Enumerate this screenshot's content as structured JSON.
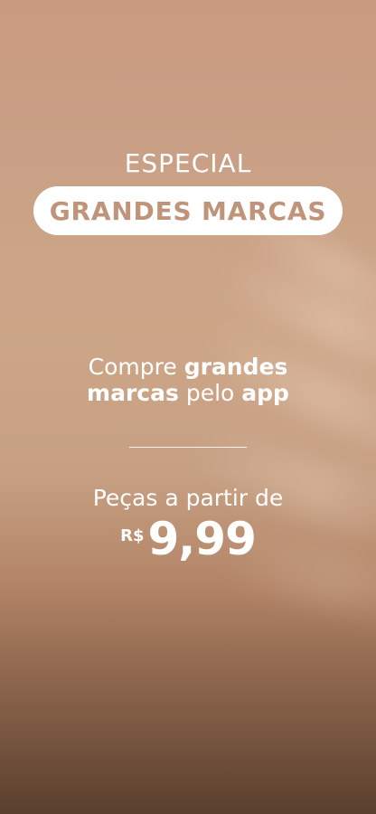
{
  "banner": {
    "eyebrow": "ESPECIAL",
    "title": "GRANDES MARCAS",
    "promo": {
      "line1_regular": "Compre ",
      "line1_bold": "grandes",
      "line2_bold": "marcas",
      "line2_regular": " pelo ",
      "line2_bold_end": "app"
    },
    "price": {
      "caption": "Peças a partir de",
      "currency": "R$",
      "amount": "9,99"
    }
  }
}
